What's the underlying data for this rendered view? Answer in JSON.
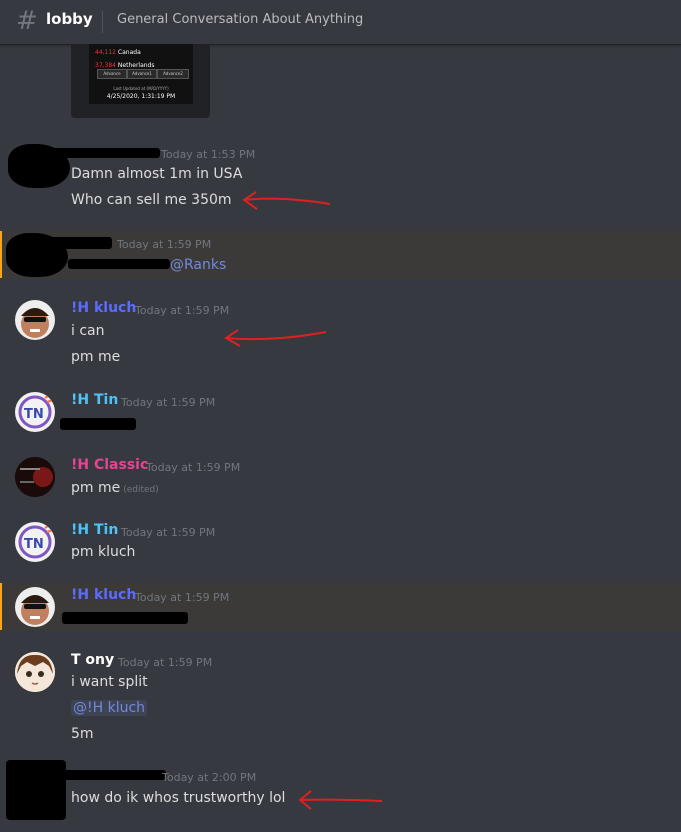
{
  "header": {
    "channel": "lobby",
    "topic": "General Conversation About Anything"
  },
  "embed": {
    "row1_num": "44,112",
    "row1_country": "Canada",
    "row2_num": "37,384",
    "row2_country": "Netherlands",
    "tabs": [
      "Advance",
      "Advance1",
      "Advance2"
    ],
    "updated_label": "Last Updated at (M/D/YYYY)",
    "updated_value": "4/25/2020, 1:31:19 PM"
  },
  "messages": [
    {
      "author": "",
      "time": "Today at 1:53 PM",
      "lines": [
        "Damn almost 1m in USA",
        "Who can sell me 350m"
      ]
    },
    {
      "author": "",
      "time": "Today at 1:59 PM",
      "mention": "@Ranks"
    },
    {
      "author": "!H kluch",
      "author_color": "#5c6bff",
      "time": "Today at 1:59 PM",
      "lines": [
        "i can",
        "pm me"
      ]
    },
    {
      "author": "!H Tin",
      "author_color": "#4fc3f7",
      "time": "Today at 1:59 PM"
    },
    {
      "author": "!H Classic",
      "author_color": "#e84393",
      "time": "Today at 1:59 PM",
      "lines": [
        "pm me"
      ],
      "edited": "(edited)"
    },
    {
      "author": "!H Tin",
      "author_color": "#4fc3f7",
      "time": "Today at 1:59 PM",
      "lines": [
        "pm kluch"
      ]
    },
    {
      "author": "!H kluch",
      "author_color": "#5c6bff",
      "time": "Today at 1:59 PM"
    },
    {
      "author": "T ony",
      "author_color": "#ffffff",
      "time": "Today at 1:59 PM",
      "lines": [
        "i want split",
        "5m"
      ],
      "mention": "@!H kluch"
    },
    {
      "author": "",
      "time": "Today at 2:00 PM",
      "lines": [
        "how do ik whos trustworthy lol"
      ]
    }
  ]
}
